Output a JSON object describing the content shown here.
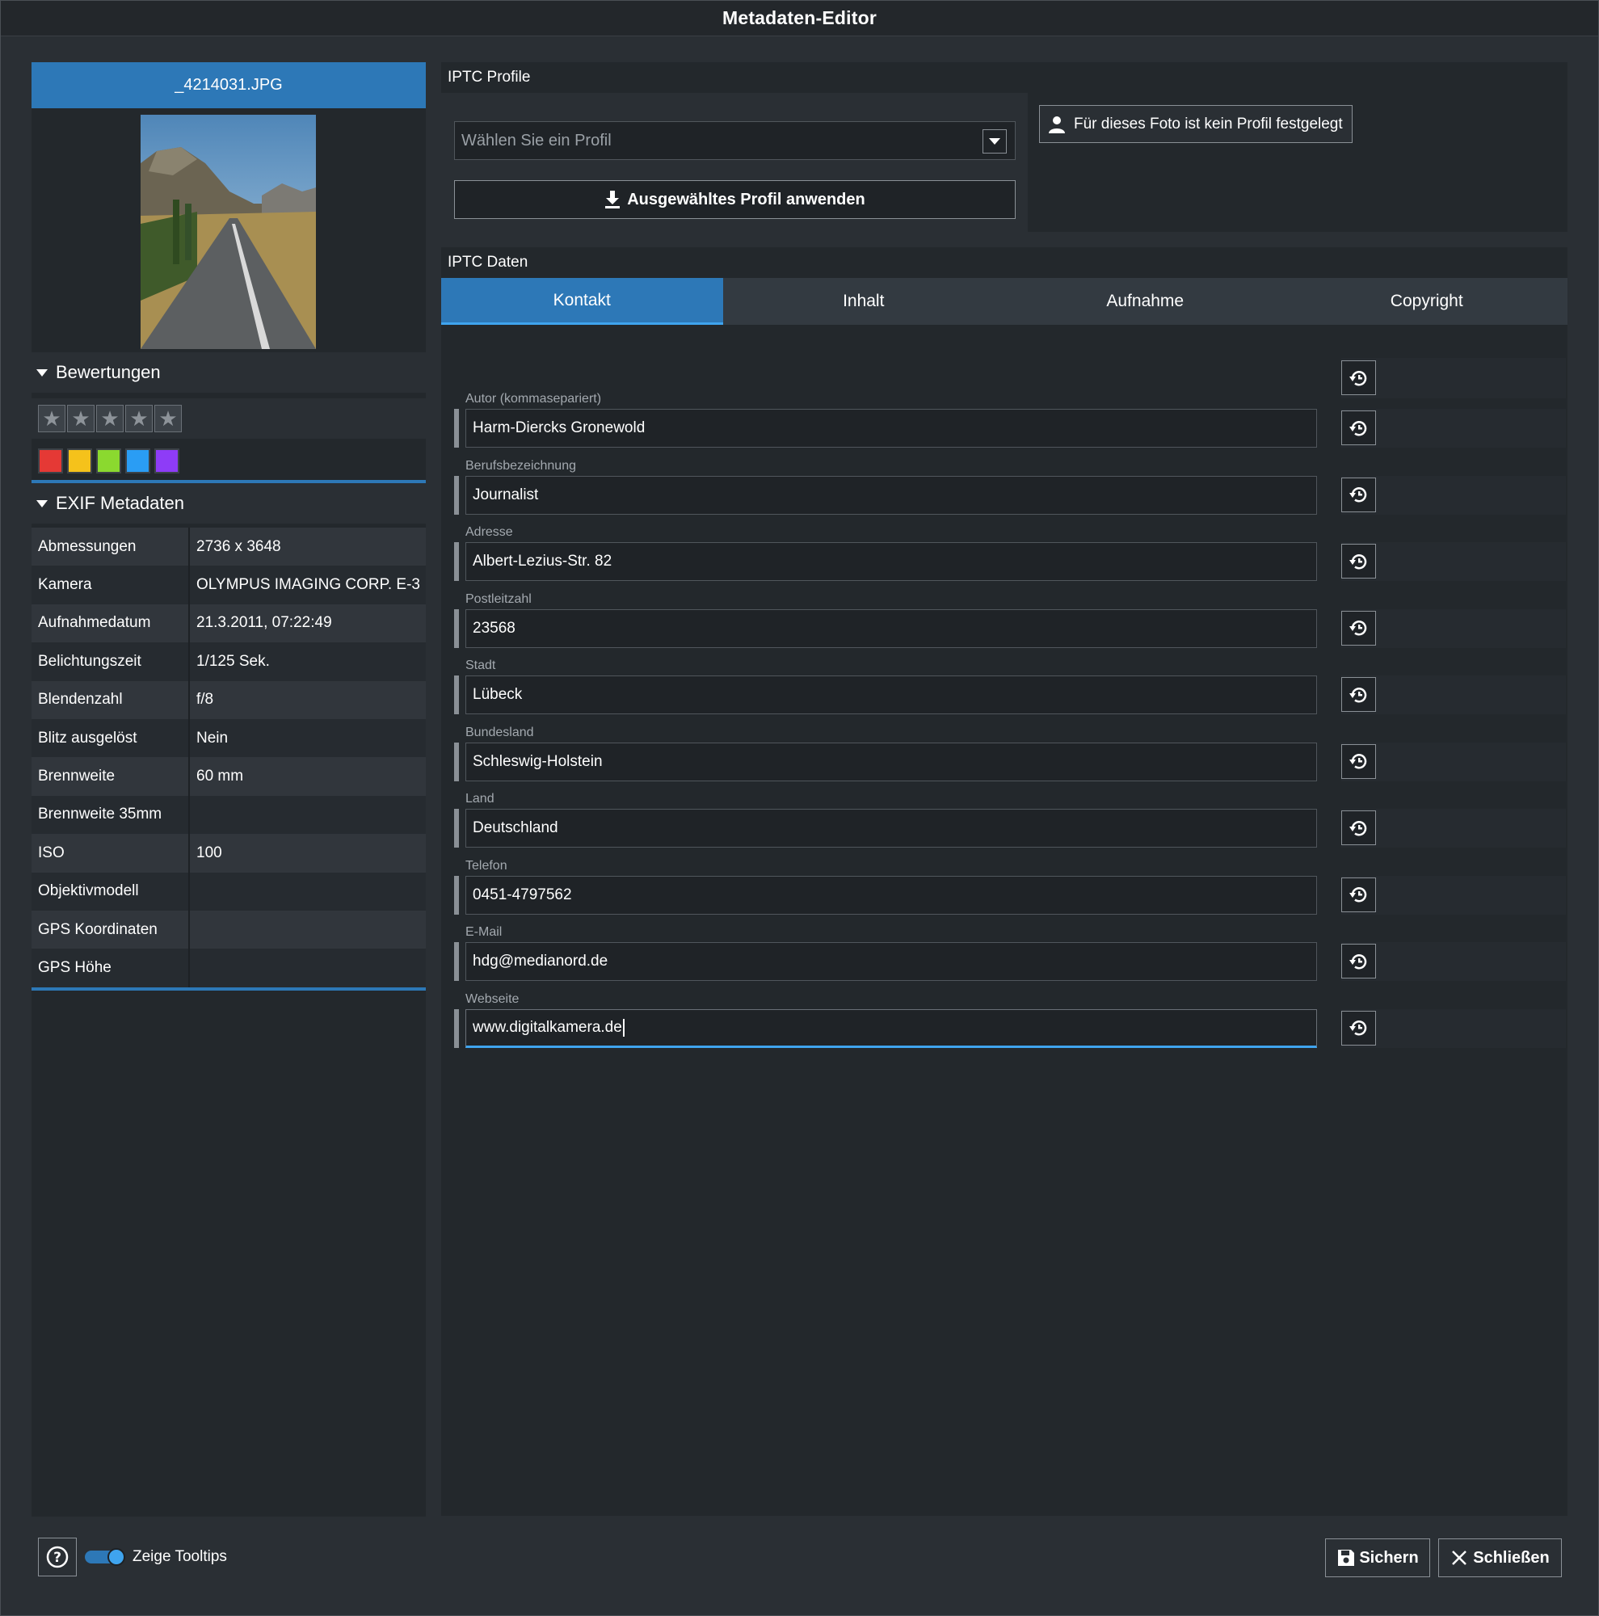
{
  "window": {
    "title": "Metadaten-Editor"
  },
  "left": {
    "filename": "_4214031.JPG",
    "ratings_header": "Bewertungen",
    "stars": {
      "rating": 0,
      "max": 5
    },
    "color_labels": [
      "#e53935",
      "#f5c21b",
      "#8bd92f",
      "#2a9df4",
      "#8e3cf7"
    ],
    "exif_header": "EXIF Metadaten",
    "exif": [
      {
        "key": "Abmessungen",
        "value": "2736 x 3648"
      },
      {
        "key": "Kamera",
        "value": "OLYMPUS IMAGING CORP. E-3"
      },
      {
        "key": "Aufnahmedatum",
        "value": "21.3.2011, 07:22:49"
      },
      {
        "key": "Belichtungszeit",
        "value": "1/125 Sek."
      },
      {
        "key": "Blendenzahl",
        "value": "f/8"
      },
      {
        "key": "Blitz ausgelöst",
        "value": "Nein"
      },
      {
        "key": "Brennweite",
        "value": "60 mm"
      },
      {
        "key": "Brennweite 35mm",
        "value": ""
      },
      {
        "key": "ISO",
        "value": "100"
      },
      {
        "key": "Objektivmodell",
        "value": ""
      },
      {
        "key": "GPS Koordinaten",
        "value": ""
      },
      {
        "key": "GPS Höhe",
        "value": ""
      }
    ]
  },
  "profile": {
    "header": "IPTC Profile",
    "select_placeholder": "Wählen Sie ein Profil",
    "apply_label": "Ausgewähltes Profil anwenden",
    "no_profile_label": "Für dieses Foto ist kein Profil festgelegt"
  },
  "data": {
    "header": "IPTC Daten",
    "tabs": [
      "Kontakt",
      "Inhalt",
      "Aufnahme",
      "Copyright"
    ],
    "active_tab": "Kontakt",
    "fields": [
      {
        "label": "Autor (kommasepariert)",
        "value": "Harm-Diercks Gronewold"
      },
      {
        "label": "Berufsbezeichnung",
        "value": "Journalist"
      },
      {
        "label": "Adresse",
        "value": "Albert-Lezius-Str. 82"
      },
      {
        "label": "Postleitzahl",
        "value": "23568"
      },
      {
        "label": "Stadt",
        "value": "Lübeck"
      },
      {
        "label": "Bundesland",
        "value": "Schleswig-Holstein"
      },
      {
        "label": "Land",
        "value": "Deutschland"
      },
      {
        "label": "Telefon",
        "value": "0451-4797562"
      },
      {
        "label": "E-Mail",
        "value": "hdg@medianord.de"
      },
      {
        "label": "Webseite",
        "value": "www.digitalkamera.de"
      }
    ]
  },
  "footer": {
    "tooltip_label": "Zeige Tooltips",
    "tooltips_enabled": true,
    "save_label": "Sichern",
    "close_label": "Schließen"
  },
  "colors": {
    "accent": "#2d78b7",
    "focus": "#3fa4ee",
    "background": "#2a2f34"
  }
}
